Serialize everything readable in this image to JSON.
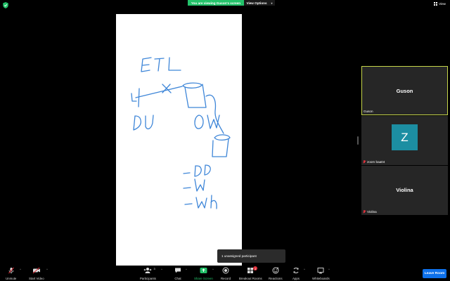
{
  "top": {
    "share_banner": "You are viewing Guson's screen",
    "view_options": "View Options",
    "view_toggle": "View"
  },
  "participants": [
    {
      "display": "Guson",
      "label": "Guson"
    },
    {
      "avatar_letter": "Z",
      "label": "zoom baa04"
    },
    {
      "display": "Violina",
      "label": "Violina"
    }
  ],
  "toast": "1 unassigned participant",
  "toolbar": {
    "unmute": "Unmute",
    "start_video": "Start Video",
    "participants": "Participants",
    "participants_count": "3",
    "chat": "Chat",
    "share_screen": "Share Screen",
    "record": "Record",
    "breakout_rooms": "Breakout Rooms",
    "breakout_badge": "1",
    "reactions": "Reactions",
    "apps": "Apps",
    "whiteboards": "Whiteboards",
    "leave": "Leave Room"
  },
  "colors": {
    "accent_green": "#23c26a",
    "leave_blue": "#0e71eb",
    "active_border": "#c6d54a",
    "avatar_teal": "#1c8ea2",
    "ink_blue": "#3e86d8",
    "mute_red": "#e0323c"
  },
  "icons": [
    "security-shield-icon",
    "grid-view-icon",
    "muted-mic-icon",
    "video-off-icon",
    "participants-icon",
    "chat-icon",
    "share-screen-icon",
    "record-icon",
    "breakout-rooms-icon",
    "reactions-icon",
    "apps-icon",
    "whiteboards-icon"
  ],
  "whiteboard_strokes": [
    "ETL",
    "y",
    "X",
    "DU",
    "OW",
    "-DD",
    "-W",
    "-wh"
  ]
}
